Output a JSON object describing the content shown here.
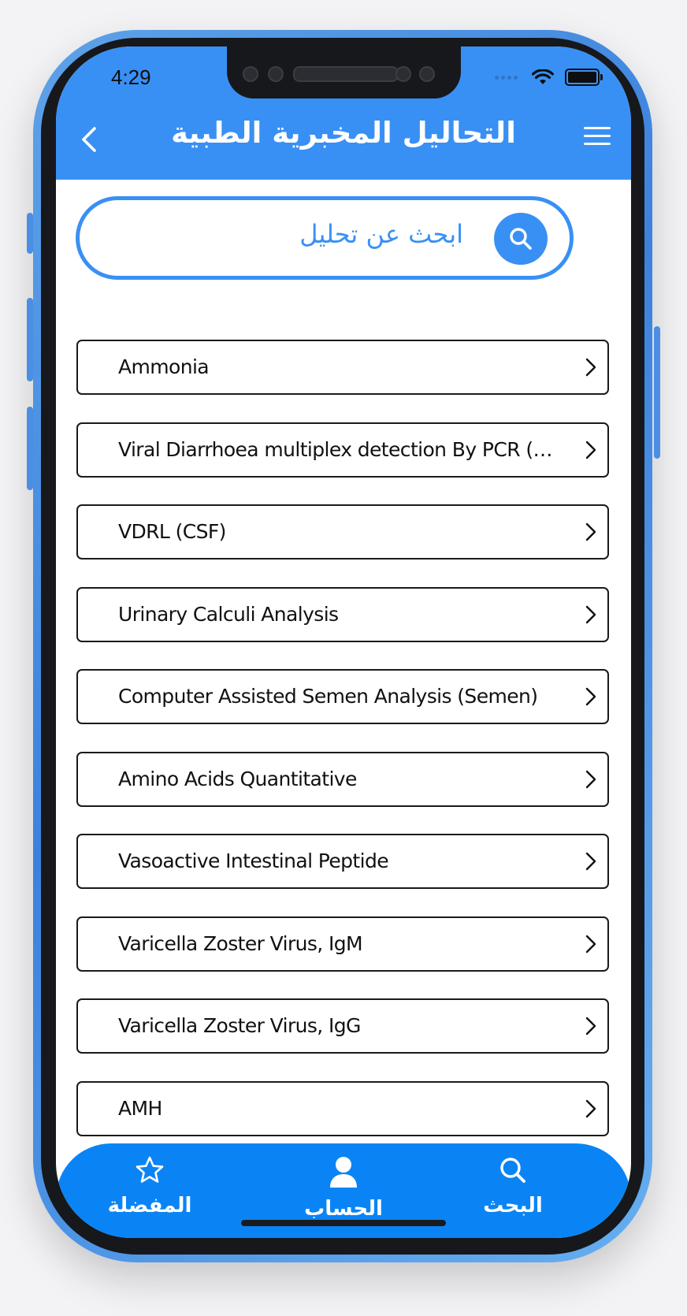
{
  "status_bar": {
    "time": "4:29"
  },
  "header": {
    "title": "التحاليل المخبرية الطبية",
    "back_icon": "chevron-left-icon",
    "menu_icon": "hamburger-menu-icon"
  },
  "search": {
    "placeholder": "ابحث عن تحليل",
    "icon": "search-icon"
  },
  "tests": [
    {
      "label": "Ammonia"
    },
    {
      "label": "Viral Diarrhoea multiplex detection By PCR (Sto…"
    },
    {
      "label": "VDRL (CSF)"
    },
    {
      "label": "Urinary Calculi Analysis"
    },
    {
      "label": "Computer Assisted Semen Analysis (Semen)"
    },
    {
      "label": "Amino Acids Quantitative"
    },
    {
      "label": "Vasoactive Intestinal Peptide"
    },
    {
      "label": "Varicella Zoster Virus, IgM"
    },
    {
      "label": "Varicella Zoster Virus, IgG"
    },
    {
      "label": "AMH"
    }
  ],
  "tab_bar": {
    "favorites": {
      "label": "المفضلة",
      "icon": "star-icon"
    },
    "account": {
      "label": "الحساب",
      "icon": "user-icon"
    },
    "search": {
      "label": "البحث",
      "icon": "search-icon"
    }
  },
  "colors": {
    "primary": "#3990f4",
    "tab_bar": "#0a84f5",
    "phone_frame": "#4a8fe2"
  }
}
